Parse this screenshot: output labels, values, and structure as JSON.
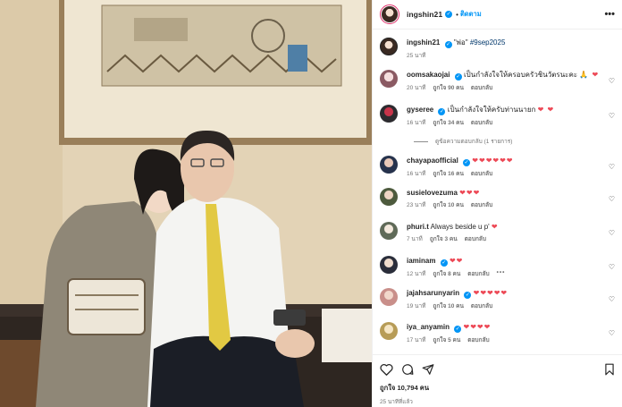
{
  "post": {
    "username": "ingshin21",
    "follow_label": "ติดตาม",
    "more_label": "•••"
  },
  "caption": {
    "username": "ingshin21",
    "text": "\"พ่อ\"",
    "hashtag": "#9sep2025",
    "time": "25 นาที"
  },
  "comments": [
    {
      "username": "oomsakaojai",
      "verified": true,
      "text": "เป็นกำลังใจให้ครอบครัวชินวัตรนะคะ",
      "emoji": "🙏 ❤",
      "time": "20 นาที",
      "likes": "ถูกใจ 90 คน",
      "reply": "ตอบกลับ"
    },
    {
      "username": "gyseree",
      "verified": true,
      "text": "เป็นกำลังใจให้ครับท่านนายก",
      "emoji": "❤ ❤",
      "time": "16 นาที",
      "likes": "ถูกใจ 34 คน",
      "reply": "ตอบกลับ",
      "view_replies": "ดูข้อความตอบกลับ (1 รายการ)"
    },
    {
      "username": "chayapaofficial",
      "verified": true,
      "text": "",
      "emoji": "❤❤❤❤❤❤",
      "time": "16 นาที",
      "likes": "ถูกใจ 16 คน",
      "reply": "ตอบกลับ"
    },
    {
      "username": "susielovezuma",
      "verified": false,
      "text": "",
      "emoji": "❤❤❤",
      "time": "23 นาที",
      "likes": "ถูกใจ 10 คน",
      "reply": "ตอบกลับ"
    },
    {
      "username": "phuri.t",
      "verified": false,
      "text": "Always beside u p'",
      "emoji": "❤",
      "time": "7 นาที",
      "likes": "ถูกใจ 3 คน",
      "reply": "ตอบกลับ"
    },
    {
      "username": "iaminam",
      "verified": true,
      "text": "",
      "emoji": "❤❤",
      "time": "12 นาที",
      "likes": "ถูกใจ 8 คน",
      "reply": "ตอบกลับ",
      "more": "•••"
    },
    {
      "username": "jajahsarunyarin",
      "verified": true,
      "text": "",
      "emoji": "❤❤❤❤❤",
      "time": "19 นาที",
      "likes": "ถูกใจ 10 คน",
      "reply": "ตอบกลับ"
    },
    {
      "username": "iya_anyamin",
      "verified": true,
      "text": "",
      "emoji": "❤❤❤❤",
      "time": "17 นาที",
      "likes": "ถูกใจ 5 คน",
      "reply": "ตอบกลับ"
    }
  ],
  "footer": {
    "likes": "ถูกใจ 10,794 คน",
    "time": "25 นาทีที่แล้ว"
  },
  "icons": {
    "like": "heart-icon",
    "comment": "comment-icon",
    "share": "share-icon",
    "save": "bookmark-icon"
  },
  "colors": {
    "accent": "#0095f6",
    "heart": "#ed4956",
    "muted": "#737373"
  }
}
